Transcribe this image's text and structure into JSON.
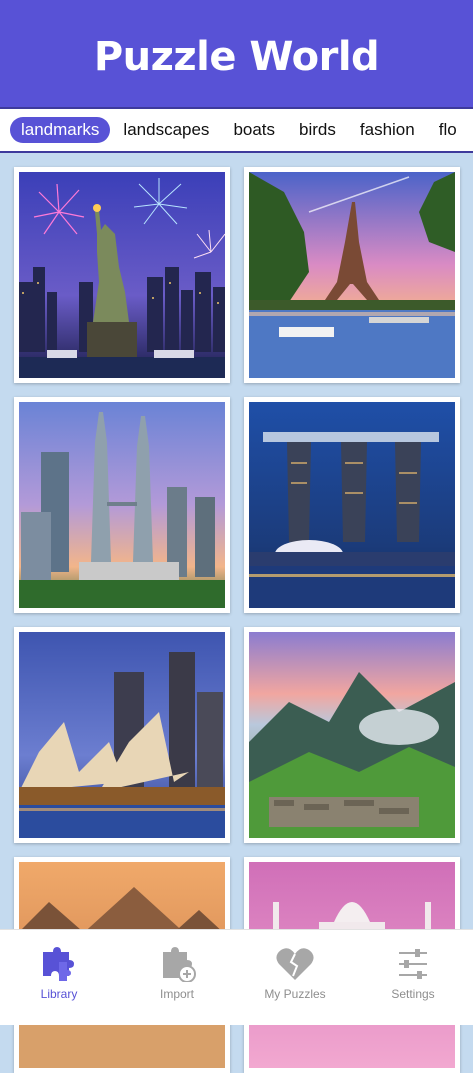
{
  "header": {
    "title": "Puzzle World"
  },
  "tabs": [
    {
      "label": "landmarks",
      "active": true
    },
    {
      "label": "landscapes"
    },
    {
      "label": "boats"
    },
    {
      "label": "birds"
    },
    {
      "label": "fashion"
    },
    {
      "label": "flo"
    }
  ],
  "puzzles": [
    {
      "icon": "statue-of-liberty-fireworks-image"
    },
    {
      "icon": "eiffel-tower-sunset-image"
    },
    {
      "icon": "petronas-towers-image"
    },
    {
      "icon": "marina-bay-sands-image"
    },
    {
      "icon": "sydney-opera-house-image"
    },
    {
      "icon": "machu-picchu-image"
    },
    {
      "icon": "pyramids-image"
    },
    {
      "icon": "taj-mahal-image"
    }
  ],
  "nav": [
    {
      "label": "Library",
      "icon": "puzzle-pieces-icon",
      "active": true
    },
    {
      "label": "Import",
      "icon": "puzzle-add-icon"
    },
    {
      "label": "My Puzzles",
      "icon": "heart-puzzle-icon"
    },
    {
      "label": "Settings",
      "icon": "sliders-icon"
    }
  ],
  "colors": {
    "accent": "#5852d6",
    "background": "#c4daef",
    "nav_inactive": "#8e8e8e"
  }
}
